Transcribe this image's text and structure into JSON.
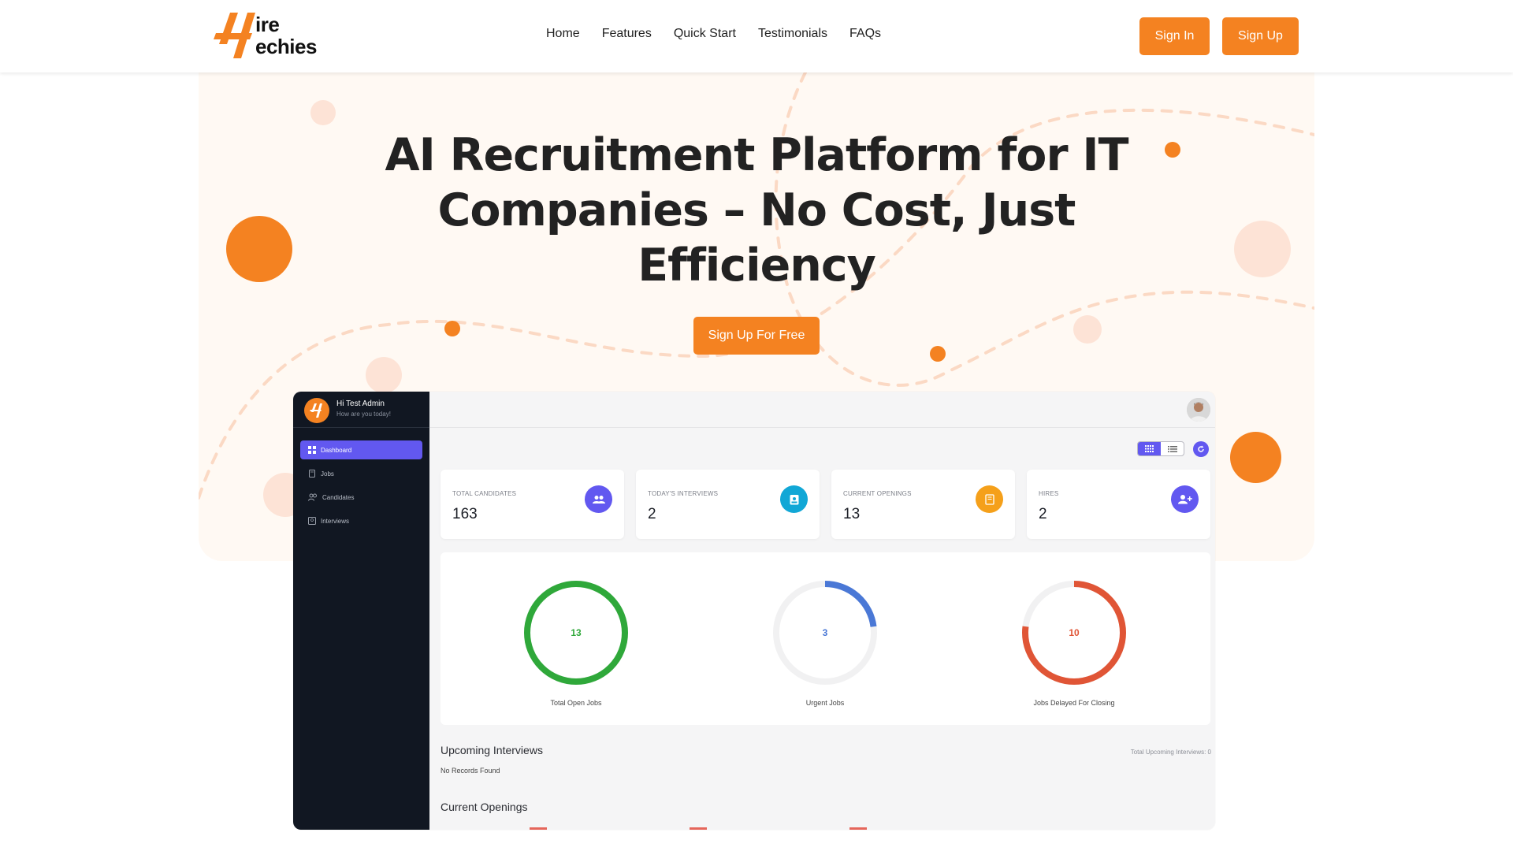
{
  "brand": {
    "logo_text_top": "ire",
    "logo_text_bottom": "echies",
    "accent": "#f48221"
  },
  "nav": {
    "links": [
      "Home",
      "Features",
      "Quick Start",
      "Testimonials",
      "FAQs"
    ],
    "sign_in": "Sign In",
    "sign_up": "Sign Up"
  },
  "hero": {
    "title_lines": [
      "AI Recruitment Platform for IT",
      "Companies – No Cost, Just",
      "Efficiency"
    ],
    "cta": "Sign Up For Free"
  },
  "dashboard": {
    "user": {
      "greeting": "Hi Test Admin",
      "subtitle": "How are you today!"
    },
    "sidebar": [
      {
        "label": "Dashboard",
        "icon": "grid-icon",
        "active": true
      },
      {
        "label": "Jobs",
        "icon": "document-icon",
        "active": false
      },
      {
        "label": "Candidates",
        "icon": "users-icon",
        "active": false
      },
      {
        "label": "Interviews",
        "icon": "id-badge-icon",
        "active": false
      }
    ],
    "stats": [
      {
        "label": "TOTAL CANDIDATES",
        "value": "163",
        "icon": "users-icon",
        "color": "#6258f0"
      },
      {
        "label": "TODAY'S INTERVIEWS",
        "value": "2",
        "icon": "id-badge-icon",
        "color": "#11a7d6"
      },
      {
        "label": "CURRENT OPENINGS",
        "value": "13",
        "icon": "document-icon",
        "color": "#f5a01a"
      },
      {
        "label": "HIRES",
        "value": "2",
        "icon": "user-plus-icon",
        "color": "#6258f0"
      }
    ],
    "donuts": [
      {
        "label": "Total Open Jobs",
        "value": "13",
        "fraction": 1.0,
        "color": "#2fa83a"
      },
      {
        "label": "Urgent Jobs",
        "value": "3",
        "fraction": 0.23,
        "color": "#4a78d6"
      },
      {
        "label": "Jobs Delayed For Closing",
        "value": "10",
        "fraction": 0.77,
        "color": "#e05536"
      }
    ],
    "upcoming": {
      "title": "Upcoming Interviews",
      "total_label": "Total Upcoming Interviews: 0",
      "empty": "No Records Found"
    },
    "openings": {
      "title": "Current Openings"
    }
  }
}
